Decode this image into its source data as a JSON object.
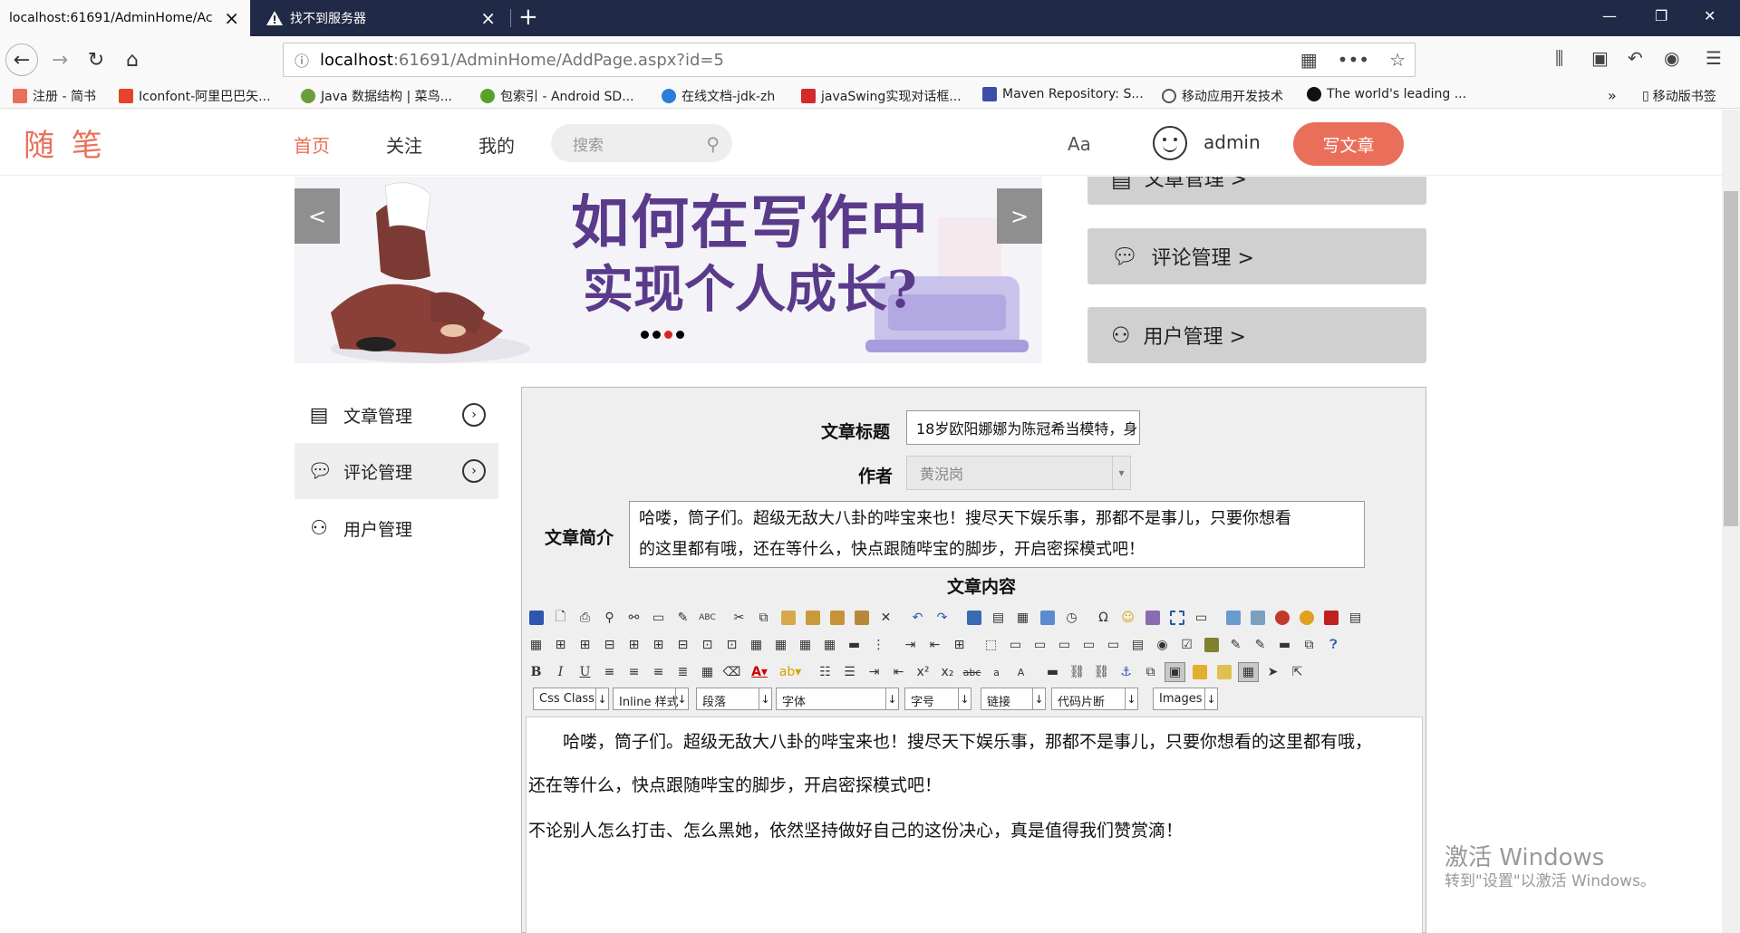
{
  "browser": {
    "tabs": [
      {
        "title": "localhost:61691/AdminHome/Ac"
      },
      {
        "title": "找不到服务器"
      }
    ],
    "url_host": "localhost",
    "url_rest": ":61691/AdminHome/AddPage.aspx?id=5",
    "bookmarks": [
      {
        "label": "注册 - 简书",
        "color": "#ea6f5a"
      },
      {
        "label": "Iconfont-阿里巴巴矢...",
        "color": "#e5432a"
      },
      {
        "label": "Java 数据结构 | 菜鸟...",
        "color": "#6b9e3a"
      },
      {
        "label": "包索引 - Android SD...",
        "color": "#56a32a"
      },
      {
        "label": "在线文档-jdk-zh",
        "color": "#2a7fd4"
      },
      {
        "label": "javaSwing实现对话框...",
        "color": "#d42a2a"
      },
      {
        "label": "Maven Repository: S...",
        "color": "#3b4fa8"
      },
      {
        "label": "移动应用开发技术",
        "color": "#555555"
      },
      {
        "label": "The world's leading ...",
        "color": "#111111"
      }
    ],
    "mobile_bookmarks": "移动版书签"
  },
  "site": {
    "logo": "随 笔",
    "nav": {
      "home": "首页",
      "follow": "关注",
      "mine": "我的"
    },
    "search_placeholder": "搜索",
    "font_toggle": "Aa",
    "username": "admin",
    "write_button": "写文章",
    "accent_color": "#ea6f5a"
  },
  "carousel": {
    "prev": "<",
    "next": ">",
    "headline_1": "如何在写作中",
    "headline_2": "实现个人成长?",
    "active_dot": 3,
    "dot_count": 4
  },
  "right_panels": [
    {
      "label": "文章管理 >",
      "icon": "document-icon"
    },
    {
      "label": "评论管理 >",
      "icon": "comment-icon"
    },
    {
      "label": "用户管理 >",
      "icon": "users-icon"
    }
  ],
  "side_menu": [
    {
      "label": "文章管理",
      "icon": "document-icon"
    },
    {
      "label": "评论管理",
      "icon": "comment-icon"
    },
    {
      "label": "用户管理",
      "icon": "users-icon"
    }
  ],
  "form": {
    "title_label": "文章标题",
    "title_value": "18岁欧阳娜娜为陈冠希当模特，身",
    "author_label": "作者",
    "author_value": "黄淣岗",
    "summary_label": "文章简介",
    "summary_line1": "哈喽，筒子们。超级无敌大八卦的哔宝来也！搜尽天下娱乐事，那都不是事儿，只要你想看",
    "summary_line2": "的这里都有哦，还在等什么，快点跟随哔宝的脚步，开启密探模式吧！",
    "content_label": "文章内容"
  },
  "editor": {
    "dropdowns": [
      "Css Class",
      "Inline 样式",
      "段落",
      "字体",
      "字号",
      "链接",
      "代码片断",
      "Images"
    ],
    "content": [
      "哈喽，筒子们。超级无敌大八卦的哔宝来也！搜尽天下娱乐事，那都不是事儿，只要你想看的这里都有哦，",
      "还在等什么，快点跟随哔宝的脚步，开启密探模式吧！",
      "不论别人怎么打击、怎么黑她，依然坚持做好自己的这份决心，真是值得我们赞赏滴！"
    ]
  },
  "watermark": {
    "line1": "激活 Windows",
    "line2": "转到\"设置\"以激活 Windows。"
  }
}
